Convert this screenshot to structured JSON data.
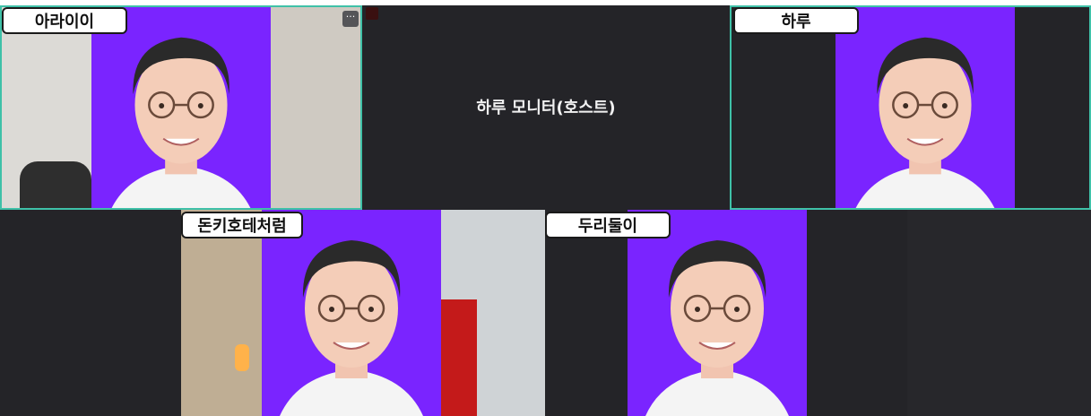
{
  "participants": [
    {
      "id": "tile-1",
      "name": "아라이이"
    },
    {
      "id": "tile-2",
      "name": "하루 모니터(호스트)"
    },
    {
      "id": "tile-3",
      "name": "하루"
    },
    {
      "id": "tile-4",
      "name": "돈키호테처럼"
    },
    {
      "id": "tile-5",
      "name": "두리둘이"
    }
  ],
  "icons": {
    "more": "more-options-icon",
    "mic": "mic-muted-icon",
    "more_glyph": "···"
  },
  "colors": {
    "tile_bg": "#242428",
    "active_border": "#3fc1a8",
    "portrait_bg": "#7a24ff"
  }
}
